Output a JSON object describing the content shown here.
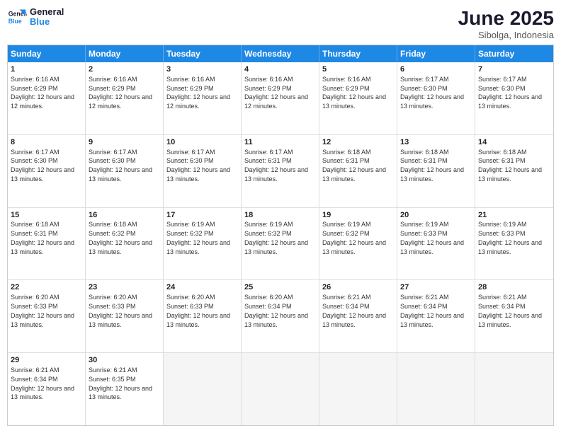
{
  "logo": {
    "line1": "General",
    "line2": "Blue"
  },
  "title": "June 2025",
  "location": "Sibolga, Indonesia",
  "weekdays": [
    "Sunday",
    "Monday",
    "Tuesday",
    "Wednesday",
    "Thursday",
    "Friday",
    "Saturday"
  ],
  "weeks": [
    [
      {
        "day": "1",
        "sunrise": "6:16 AM",
        "sunset": "6:29 PM",
        "daylight": "12 hours and 12 minutes."
      },
      {
        "day": "2",
        "sunrise": "6:16 AM",
        "sunset": "6:29 PM",
        "daylight": "12 hours and 12 minutes."
      },
      {
        "day": "3",
        "sunrise": "6:16 AM",
        "sunset": "6:29 PM",
        "daylight": "12 hours and 12 minutes."
      },
      {
        "day": "4",
        "sunrise": "6:16 AM",
        "sunset": "6:29 PM",
        "daylight": "12 hours and 12 minutes."
      },
      {
        "day": "5",
        "sunrise": "6:16 AM",
        "sunset": "6:29 PM",
        "daylight": "12 hours and 13 minutes."
      },
      {
        "day": "6",
        "sunrise": "6:17 AM",
        "sunset": "6:30 PM",
        "daylight": "12 hours and 13 minutes."
      },
      {
        "day": "7",
        "sunrise": "6:17 AM",
        "sunset": "6:30 PM",
        "daylight": "12 hours and 13 minutes."
      }
    ],
    [
      {
        "day": "8",
        "sunrise": "6:17 AM",
        "sunset": "6:30 PM",
        "daylight": "12 hours and 13 minutes."
      },
      {
        "day": "9",
        "sunrise": "6:17 AM",
        "sunset": "6:30 PM",
        "daylight": "12 hours and 13 minutes."
      },
      {
        "day": "10",
        "sunrise": "6:17 AM",
        "sunset": "6:30 PM",
        "daylight": "12 hours and 13 minutes."
      },
      {
        "day": "11",
        "sunrise": "6:17 AM",
        "sunset": "6:31 PM",
        "daylight": "12 hours and 13 minutes."
      },
      {
        "day": "12",
        "sunrise": "6:18 AM",
        "sunset": "6:31 PM",
        "daylight": "12 hours and 13 minutes."
      },
      {
        "day": "13",
        "sunrise": "6:18 AM",
        "sunset": "6:31 PM",
        "daylight": "12 hours and 13 minutes."
      },
      {
        "day": "14",
        "sunrise": "6:18 AM",
        "sunset": "6:31 PM",
        "daylight": "12 hours and 13 minutes."
      }
    ],
    [
      {
        "day": "15",
        "sunrise": "6:18 AM",
        "sunset": "6:31 PM",
        "daylight": "12 hours and 13 minutes."
      },
      {
        "day": "16",
        "sunrise": "6:18 AM",
        "sunset": "6:32 PM",
        "daylight": "12 hours and 13 minutes."
      },
      {
        "day": "17",
        "sunrise": "6:19 AM",
        "sunset": "6:32 PM",
        "daylight": "12 hours and 13 minutes."
      },
      {
        "day": "18",
        "sunrise": "6:19 AM",
        "sunset": "6:32 PM",
        "daylight": "12 hours and 13 minutes."
      },
      {
        "day": "19",
        "sunrise": "6:19 AM",
        "sunset": "6:32 PM",
        "daylight": "12 hours and 13 minutes."
      },
      {
        "day": "20",
        "sunrise": "6:19 AM",
        "sunset": "6:33 PM",
        "daylight": "12 hours and 13 minutes."
      },
      {
        "day": "21",
        "sunrise": "6:19 AM",
        "sunset": "6:33 PM",
        "daylight": "12 hours and 13 minutes."
      }
    ],
    [
      {
        "day": "22",
        "sunrise": "6:20 AM",
        "sunset": "6:33 PM",
        "daylight": "12 hours and 13 minutes."
      },
      {
        "day": "23",
        "sunrise": "6:20 AM",
        "sunset": "6:33 PM",
        "daylight": "12 hours and 13 minutes."
      },
      {
        "day": "24",
        "sunrise": "6:20 AM",
        "sunset": "6:33 PM",
        "daylight": "12 hours and 13 minutes."
      },
      {
        "day": "25",
        "sunrise": "6:20 AM",
        "sunset": "6:34 PM",
        "daylight": "12 hours and 13 minutes."
      },
      {
        "day": "26",
        "sunrise": "6:21 AM",
        "sunset": "6:34 PM",
        "daylight": "12 hours and 13 minutes."
      },
      {
        "day": "27",
        "sunrise": "6:21 AM",
        "sunset": "6:34 PM",
        "daylight": "12 hours and 13 minutes."
      },
      {
        "day": "28",
        "sunrise": "6:21 AM",
        "sunset": "6:34 PM",
        "daylight": "12 hours and 13 minutes."
      }
    ],
    [
      {
        "day": "29",
        "sunrise": "6:21 AM",
        "sunset": "6:34 PM",
        "daylight": "12 hours and 13 minutes."
      },
      {
        "day": "30",
        "sunrise": "6:21 AM",
        "sunset": "6:35 PM",
        "daylight": "12 hours and 13 minutes."
      },
      null,
      null,
      null,
      null,
      null
    ]
  ]
}
